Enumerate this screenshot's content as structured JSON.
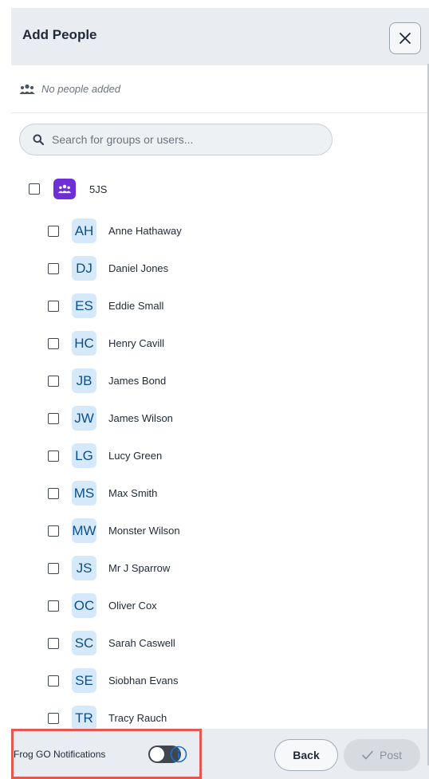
{
  "dialog": {
    "title": "Add People",
    "close_icon": "close-icon"
  },
  "added": {
    "icon": "people-icon",
    "empty_text": "No people added"
  },
  "search": {
    "icon": "search-icon",
    "placeholder": "Search for groups or users..."
  },
  "group": {
    "icon": "group-icon",
    "label": "5JS",
    "icon_color": "#6f2fd6"
  },
  "users": [
    {
      "initials": "AH",
      "name": "Anne Hathaway"
    },
    {
      "initials": "DJ",
      "name": "Daniel Jones"
    },
    {
      "initials": "ES",
      "name": "Eddie Small"
    },
    {
      "initials": "HC",
      "name": "Henry Cavill"
    },
    {
      "initials": "JB",
      "name": "James Bond"
    },
    {
      "initials": "JW",
      "name": "James Wilson"
    },
    {
      "initials": "LG",
      "name": "Lucy Green"
    },
    {
      "initials": "MS",
      "name": "Max Smith"
    },
    {
      "initials": "MW",
      "name": "Monster Wilson"
    },
    {
      "initials": "JS",
      "name": "Mr J Sparrow"
    },
    {
      "initials": "OC",
      "name": "Oliver Cox"
    },
    {
      "initials": "SC",
      "name": "Sarah Caswell"
    },
    {
      "initials": "SE",
      "name": "Siobhan Evans"
    },
    {
      "initials": "TR",
      "name": "Tracy Rauch"
    }
  ],
  "footer": {
    "notifications_label": "Frog GO Notifications",
    "notifications_on": false,
    "info_icon": "info-icon",
    "back_label": "Back",
    "post_label": "Post",
    "post_icon": "check-icon",
    "highlight_color": "#e05a4f"
  }
}
